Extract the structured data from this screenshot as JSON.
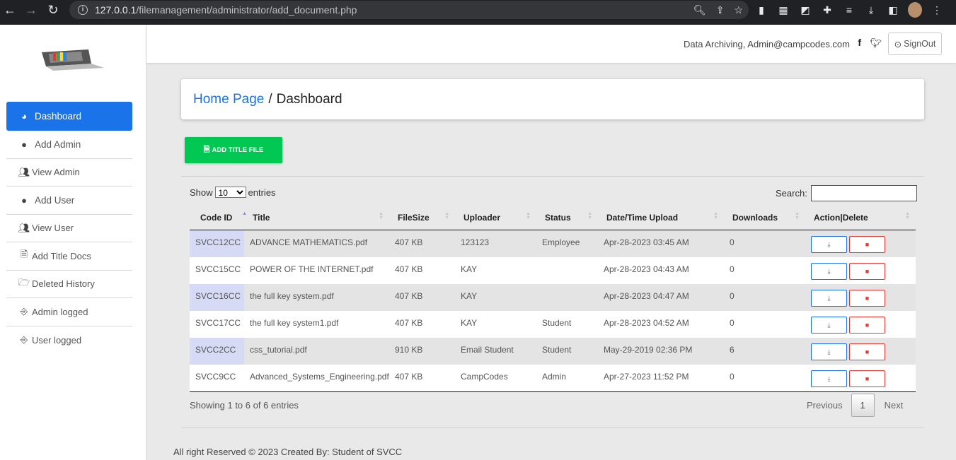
{
  "browser": {
    "url_host": "127.0.0.1",
    "url_path": "/filemanagement/administrator/add_document.php"
  },
  "header": {
    "user_info": "Data Archiving, Admin@campcodes.com",
    "signout_label": "SignOut"
  },
  "sidebar": {
    "items": [
      {
        "label": "Dashboard",
        "icon": "chart-pie-icon"
      },
      {
        "label": "Add Admin",
        "icon": "user-icon"
      },
      {
        "label": "View Admin",
        "icon": "users-icon"
      },
      {
        "label": "Add User",
        "icon": "user-icon"
      },
      {
        "label": "View User",
        "icon": "users-icon"
      },
      {
        "label": "Add Title Docs",
        "icon": "file-plus-icon"
      },
      {
        "label": "Deleted History",
        "icon": "folder-open-icon"
      },
      {
        "label": "Admin logged",
        "icon": "login-icon"
      },
      {
        "label": "User logged",
        "icon": "login-icon"
      }
    ]
  },
  "breadcrumb": {
    "home": "Home Page",
    "separator": "/",
    "current": "Dashboard"
  },
  "add_button_label": "ADD TITLE FILE",
  "table_controls": {
    "show_label": "Show",
    "page_size": "10",
    "entries_label": "entries",
    "search_label": "Search:"
  },
  "table": {
    "columns": [
      "Code ID",
      "Title",
      "FileSize",
      "Uploader",
      "Status",
      "Date/Time Upload",
      "Downloads",
      "Action|Delete"
    ],
    "rows": [
      {
        "code": "SVCC12CC",
        "title": "ADVANCE MATHEMATICS.pdf",
        "size": "407 KB",
        "uploader": "123123",
        "status": "Employee",
        "date": "Apr-28-2023 03:45 AM",
        "downloads": "0"
      },
      {
        "code": "SVCC15CC",
        "title": "POWER OF THE INTERNET.pdf",
        "size": "407 KB",
        "uploader": "KAY",
        "status": "",
        "date": "Apr-28-2023 04:43 AM",
        "downloads": "0"
      },
      {
        "code": "SVCC16CC",
        "title": "the full key system.pdf",
        "size": "407 KB",
        "uploader": "KAY",
        "status": "",
        "date": "Apr-28-2023 04:47 AM",
        "downloads": "0"
      },
      {
        "code": "SVCC17CC",
        "title": "the full key system1.pdf",
        "size": "407 KB",
        "uploader": "KAY",
        "status": "Student",
        "date": "Apr-28-2023 04:52 AM",
        "downloads": "0"
      },
      {
        "code": "SVCC2CC",
        "title": "css_tutorial.pdf",
        "size": "910 KB",
        "uploader": "Email Student",
        "status": "Student",
        "date": "May-29-2019 02:36 PM",
        "downloads": "6"
      },
      {
        "code": "SVCC9CC",
        "title": "Advanced_Systems_Engineering.pdf",
        "size": "407 KB",
        "uploader": "CampCodes",
        "status": "Admin",
        "date": "Apr-27-2023 11:52 PM",
        "downloads": "0"
      }
    ]
  },
  "table_footer": {
    "info": "Showing 1 to 6 of 6 entries",
    "previous": "Previous",
    "page": "1",
    "next": "Next"
  },
  "footer_text": "All right Reserved © 2023 Created By: Student of SVCC"
}
